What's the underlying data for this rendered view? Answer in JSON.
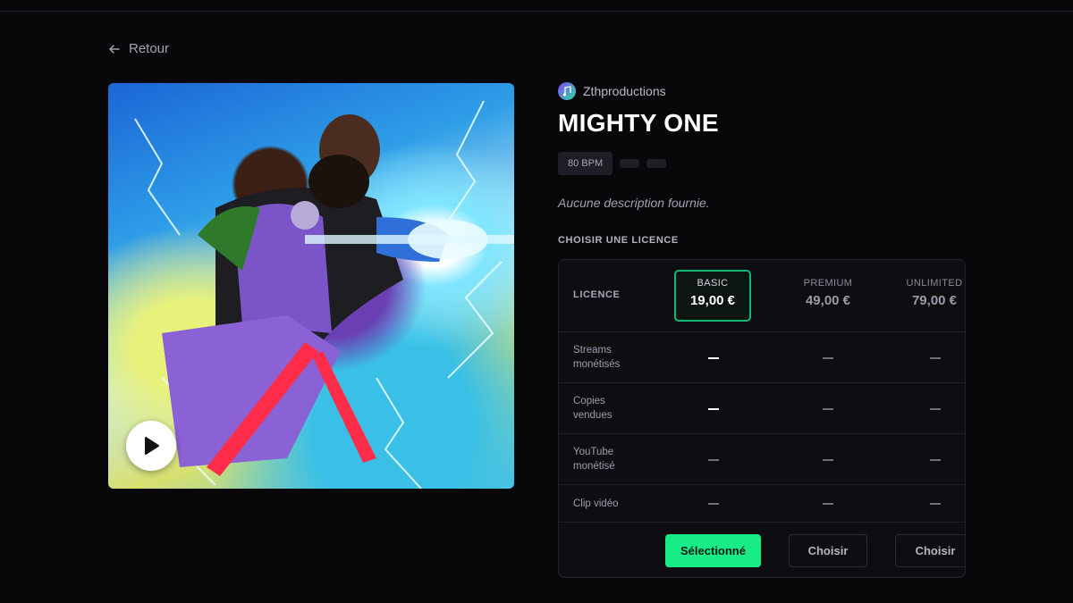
{
  "nav": {
    "back_label": "Retour"
  },
  "beat": {
    "producer": "Zthproductions",
    "title": "MIGHTY ONE",
    "tags": [
      "80 BPM"
    ],
    "description": "Aucune description fournie."
  },
  "licenses": {
    "section_label": "CHOISIR UNE LICENCE",
    "header_label": "LICENCE",
    "plans": [
      {
        "name": "BASIC",
        "price": "19,00 €",
        "selected": true,
        "button": "Sélectionné"
      },
      {
        "name": "PREMIUM",
        "price": "49,00 €",
        "selected": false,
        "button": "Choisir"
      },
      {
        "name": "UNLIMITED",
        "price": "79,00 €",
        "selected": false,
        "button": "Choisir"
      }
    ],
    "features": [
      {
        "label_line1": "Streams",
        "label_line2": "monétisés",
        "values": [
          "—",
          "—",
          "—"
        ]
      },
      {
        "label_line1": "Copies",
        "label_line2": "vendues",
        "values": [
          "—",
          "—",
          "—"
        ]
      },
      {
        "label_line1": "YouTube",
        "label_line2": "monétisé",
        "values": [
          "—",
          "—",
          "—"
        ]
      },
      {
        "label_line1": "Clip vidéo",
        "label_line2": "",
        "values": [
          "—",
          "—",
          "—"
        ]
      }
    ]
  },
  "colors": {
    "background": "#08080b",
    "accent_green": "#18ec86",
    "selected_border": "#10b873"
  },
  "icons": {
    "back": "arrow-left-icon",
    "play": "play-icon"
  }
}
